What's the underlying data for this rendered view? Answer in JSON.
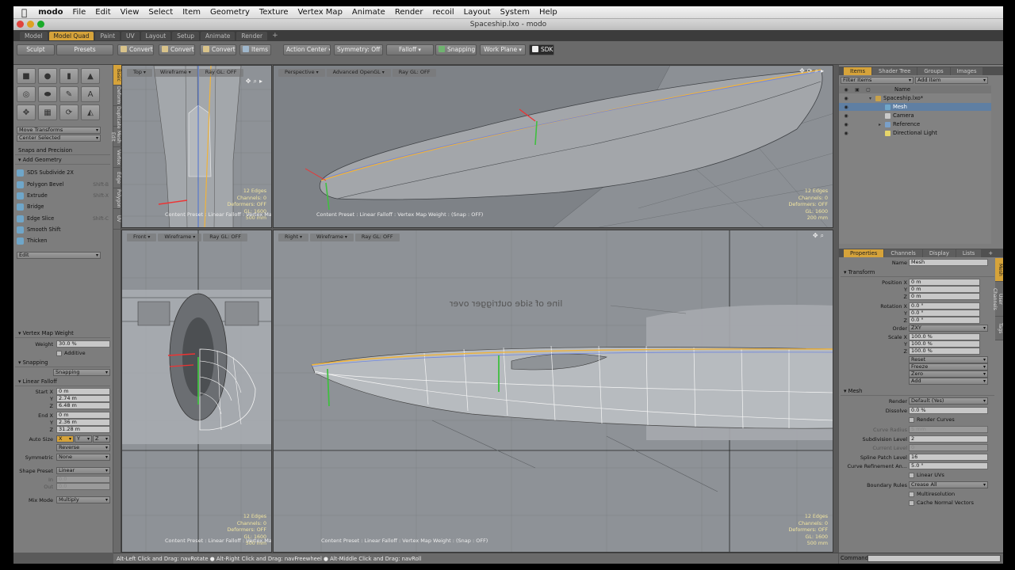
{
  "menubar": {
    "app": "modo",
    "items": [
      "File",
      "Edit",
      "View",
      "Select",
      "Item",
      "Geometry",
      "Texture",
      "Vertex Map",
      "Animate",
      "Render",
      "recoil",
      "Layout",
      "System",
      "Help"
    ]
  },
  "window": {
    "title": "Spaceship.lxo - modo"
  },
  "layout_tabs": {
    "items": [
      "Model",
      "Model Quad",
      "Paint",
      "UV",
      "Layout",
      "Setup",
      "Animate",
      "Render"
    ],
    "active": "Model Quad",
    "plus": "+"
  },
  "toolbar": {
    "sculpt": "Sculpt",
    "presets": "Presets",
    "convert1": "Convert",
    "convert2": "Convert",
    "convert3": "Convert",
    "items": "Items",
    "action_center": "Action Center",
    "symmetry": "Symmetry: Off",
    "falloff": "Falloff",
    "snapping": "Snapping",
    "work_plane": "Work Plane",
    "sdk": "SDK"
  },
  "left_tabs": [
    "Basic",
    "Deform",
    "Duplicate",
    "Mesh Edit",
    "Vertex",
    "Edge",
    "Polygon",
    "UV"
  ],
  "left_panel": {
    "move_transforms": "Move Transforms",
    "center_selected": "Center Selected",
    "snaps_precision": "Snaps and Precision",
    "add_geometry": "Add Geometry",
    "tools": [
      {
        "label": "SDS Subdivide 2X",
        "shortcut": ""
      },
      {
        "label": "Polygon Bevel",
        "shortcut": "Shift-B"
      },
      {
        "label": "Extrude",
        "shortcut": "Shift-X"
      },
      {
        "label": "Bridge",
        "shortcut": ""
      },
      {
        "label": "Edge Slice",
        "shortcut": "Shift-C"
      },
      {
        "label": "Smooth Shift",
        "shortcut": ""
      },
      {
        "label": "Thicken",
        "shortcut": ""
      }
    ],
    "edit": "Edit",
    "vmap_weight": "Vertex Map Weight",
    "weight_label": "Weight",
    "weight_value": "30.0 %",
    "additive": "Additive",
    "snapping_section": "Snapping",
    "snapping_btn": "Snapping",
    "linear_falloff": "Linear Falloff",
    "start_x_label": "Start X",
    "start_x": "0 m",
    "start_y": "2.74 m",
    "start_z": "6.48 m",
    "end_x_label": "End X",
    "end_x": "0 m",
    "end_y": "2.36 m",
    "end_z": "31.28 m",
    "auto_size": "Auto Size",
    "reverse": "Reverse",
    "symmetric_label": "Symmetric",
    "symmetric_value": "None",
    "shape_preset_label": "Shape Preset",
    "shape_preset_value": "Linear",
    "in_label": "In",
    "out_label": "Out",
    "in_value": "0.0",
    "out_value": "0.0",
    "mix_mode_label": "Mix Mode",
    "mix_mode_value": "Multiply"
  },
  "viewports": {
    "top": {
      "view": "Top",
      "shade": "Wireframe",
      "raygl": "Ray GL: OFF",
      "stats": [
        "12 Edges",
        "Channels: 0",
        "Deformers: OFF",
        "GL: 1600",
        "500 mm"
      ],
      "footer": "Content Preset : Linear Falloff : Vertex Map W"
    },
    "perspective": {
      "view": "Perspective",
      "shade": "Advanced OpenGL",
      "raygl": "Ray GL: OFF",
      "stats": [
        "12 Edges",
        "Channels: 0",
        "Deformers: OFF",
        "GL: 1600",
        "200 mm"
      ],
      "footer": "Content Preset : Linear Falloff : Vertex Map Weight : (Snap : OFF)"
    },
    "front": {
      "view": "Front",
      "shade": "Wireframe",
      "raygl": "Ray GL: OFF",
      "stats": [
        "12 Edges",
        "Channels: 0",
        "Deformers: OFF",
        "GL: 1600",
        "500 mm"
      ],
      "footer": "Content Preset : Linear Falloff : Vertex Map W"
    },
    "right": {
      "view": "Right",
      "shade": "Wireframe",
      "raygl": "Ray GL: OFF",
      "stats": [
        "12 Edges",
        "Channels: 0",
        "Deformers: OFF",
        "GL: 1600",
        "500 mm"
      ],
      "footer": "Content Preset : Linear Falloff : Vertex Map Weight : (Snap : OFF)",
      "mirrored_text": "line of side outrigger over"
    }
  },
  "right_panel": {
    "tabs": [
      "Items",
      "Shader Tree",
      "Groups",
      "Images"
    ],
    "filter": "Filter Items",
    "add_item": "Add Item",
    "name_col": "Name",
    "tree": [
      {
        "label": "Spaceship.lxo*",
        "indent": 0,
        "expander": "▾",
        "sel": false,
        "color": "#c9a24a"
      },
      {
        "label": "Mesh",
        "indent": 1,
        "expander": "",
        "sel": true,
        "color": "#6fa6c9"
      },
      {
        "label": "Camera",
        "indent": 1,
        "expander": "",
        "sel": false,
        "color": "#c9c9c9"
      },
      {
        "label": "Reference",
        "indent": 1,
        "expander": "▸",
        "sel": false,
        "color": "#7aa0c9"
      },
      {
        "label": "Directional Light",
        "indent": 1,
        "expander": "",
        "sel": false,
        "color": "#e6d56a"
      }
    ],
    "prop_tabs": [
      "Properties",
      "Channels",
      "Display",
      "Lists"
    ],
    "prop_plus": "+",
    "prop_vtabs": [
      "Mesh",
      "User Channels",
      "Tags"
    ],
    "name_label": "Name",
    "name_value": "Mesh",
    "transform": "Transform",
    "position_label": "Position X",
    "pos": [
      "0 m",
      "0 m",
      "0 m"
    ],
    "rotation_label": "Rotation X",
    "rot": [
      "0.0 °",
      "0.0 °",
      "0.0 °"
    ],
    "order_label": "Order",
    "order_value": "ZXY",
    "scale_label": "Scale X",
    "scale": [
      "100.0 %",
      "100.0 %",
      "100.0 %"
    ],
    "reset": "Reset",
    "freeze": "Freeze",
    "zero": "Zero",
    "add": "Add",
    "mesh_section": "Mesh",
    "render_label": "Render",
    "render_value": "Default (Yes)",
    "dissolve_label": "Dissolve",
    "dissolve_value": "0.0 %",
    "render_curves": "Render Curves",
    "curve_radius_label": "Curve Radius",
    "curve_radius_value": "5 mm",
    "subdiv_label": "Subdivision Level",
    "subdiv_value": "2",
    "current_level_label": "Current Level",
    "current_level_value": "0",
    "spline_label": "Spline Patch Level",
    "spline_value": "16",
    "curve_ref_label": "Curve Refinement An...",
    "curve_ref_value": "5.0 °",
    "linear_uvs": "Linear UVs",
    "boundary_label": "Boundary Rules",
    "boundary_value": "Crease All",
    "multires": "Multiresolution",
    "cache": "Cache Normal Vectors"
  },
  "statusbar": {
    "text": "Alt-Left Click and Drag: navRotate ● Alt-Right Click and Drag: navFreewheel ● Alt-Middle Click and Drag: navRoll"
  },
  "command": {
    "label": "Command"
  },
  "axes": {
    "x": "X",
    "y": "Y",
    "z": "Z"
  },
  "colors": {
    "accent": "#d6a33a",
    "selection": "#5f7fa3",
    "viewport": "#8e9297",
    "edge_highlight": "#f0b33a"
  }
}
